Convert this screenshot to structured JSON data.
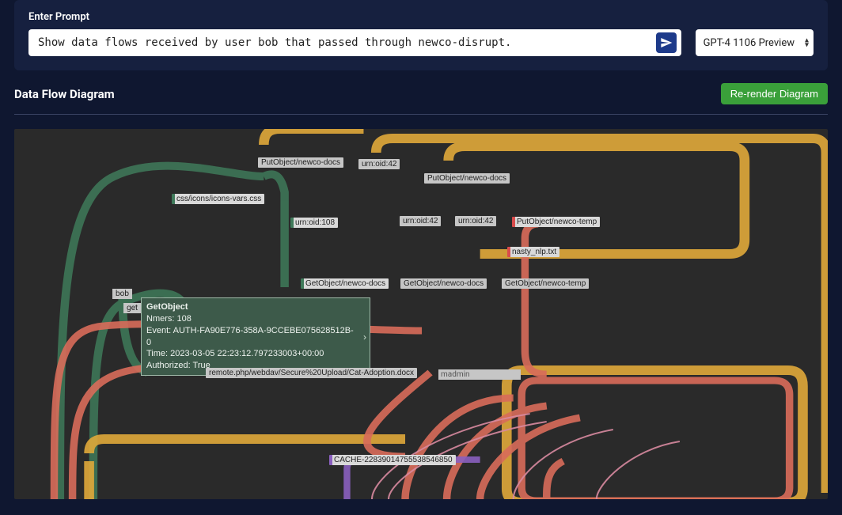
{
  "prompt": {
    "label": "Enter Prompt",
    "value": "Show data flows received by user bob that passed through newco-disrupt.",
    "model_selected": "GPT-4 1106 Preview"
  },
  "diagram": {
    "title": "Data Flow Diagram",
    "rerender_label": "Re-render Diagram"
  },
  "nodes": {
    "put_docs_1": "PutObject/newco-docs",
    "put_docs_2": "PutObject/newco-docs",
    "put_temp": "PutObject/newco-temp",
    "urn42_a": "urn:oid:42",
    "urn42_b": "urn:oid:42",
    "urn42_c": "urn:oid:42",
    "urn108": "urn:oid:108",
    "css": "css/icons/icons-vars.css",
    "nasty": "nasty_nlp.txt",
    "get_docs_1": "GetObject/newco-docs",
    "get_docs_2": "GetObject/newco-docs",
    "get_temp": "GetObject/newco-temp",
    "bob": "bob",
    "get": "get",
    "remote": "remote.php/webdav/Secure%20Upload/Cat-Adoption.docx",
    "madmin": "madmin",
    "cache": "CACHE-22839014755538546850"
  },
  "tooltip": {
    "title": "GetObject",
    "nmers": "Nmers: 108",
    "event": "Event: AUTH-FA90E776-358A-9CCEBE075628512B-0",
    "time": "Time: 2023-03-05 22:23:12.797233003+00:00",
    "authorized": "Authorized: True"
  }
}
